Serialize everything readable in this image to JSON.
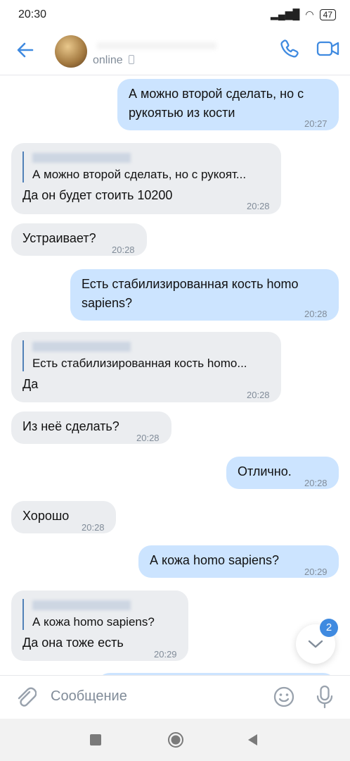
{
  "status_bar": {
    "time": "20:30",
    "battery": "47"
  },
  "header": {
    "status": "online"
  },
  "messages": [
    {
      "text": "А можно второй сделать, но с рукоятью из кости",
      "time": "20:27"
    },
    {
      "quote": "А можно второй сделать, но с рукоят...",
      "text": "Да он будет стоить 10200",
      "time": "20:28"
    },
    {
      "text": "Устраивает?",
      "time": "20:28"
    },
    {
      "text": "Есть стабилизированная кость homo sapiens?",
      "time": "20:28"
    },
    {
      "quote": "Есть стабилизированная кость homo...",
      "text": "Да",
      "time": "20:28"
    },
    {
      "text": "Из неё сделать?",
      "time": "20:28"
    },
    {
      "text": "Отлично.",
      "time": "20:28"
    },
    {
      "text": "Хорошо",
      "time": "20:28"
    },
    {
      "text": "А кожа homo sapiens?",
      "time": "20:29"
    },
    {
      "quote": "А кожа homo sapiens?",
      "text": "Да она тоже есть",
      "time": "20:29"
    }
  ],
  "scroll_down": {
    "unread_count": "2"
  },
  "composer": {
    "placeholder": "Сообщение"
  },
  "icons": {
    "back": "arrow-left-icon",
    "phone": "phone-icon",
    "video": "video-camera-icon",
    "attach": "paperclip-icon",
    "emoji": "smile-icon",
    "mic": "microphone-icon"
  },
  "colors": {
    "accent": "#3f8ae0",
    "outgoing": "#cce4ff",
    "incoming": "#ebedf0"
  }
}
